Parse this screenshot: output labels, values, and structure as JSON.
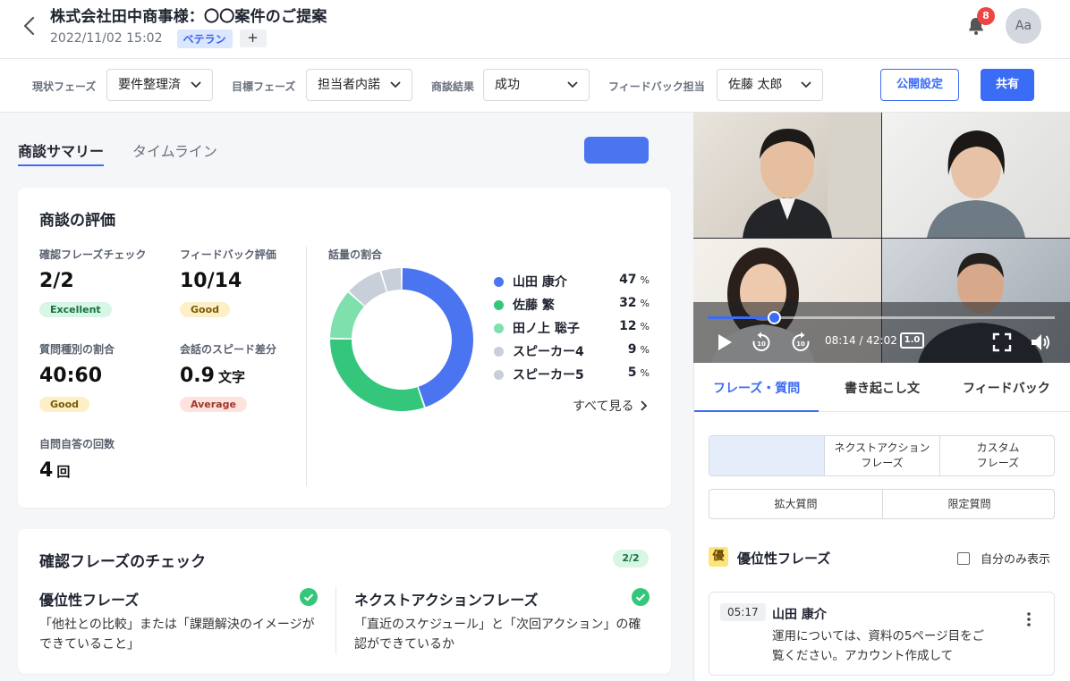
{
  "header": {
    "title": "株式会社田中商事様：〇〇案件のご提案",
    "datetime": "2022/11/02 15:02",
    "tag": "ベテラン",
    "tag_add": "+",
    "notification_count": "8",
    "avatar_initials": "Aa"
  },
  "filters": {
    "current_phase_label": "現状フェーズ",
    "current_phase_value": "要件整理済",
    "target_phase_label": "目標フェーズ",
    "target_phase_value": "担当者内諾",
    "result_label": "商談結果",
    "result_value": "成功",
    "feedback_owner_label": "フィードバック担当",
    "feedback_owner_value": "佐藤 太郎",
    "publish_button": "公開設定",
    "share_button": "共有"
  },
  "left_tabs": {
    "summary": "商談サマリー",
    "timeline": "タイムライン"
  },
  "evaluation": {
    "title": "商談の評価",
    "metrics": [
      {
        "label": "確認フレーズチェック",
        "value": "2/2",
        "unit": "",
        "badge": "Excellent"
      },
      {
        "label": "フィードバック評価",
        "value": "10/14",
        "unit": "",
        "badge": "Good"
      },
      {
        "label": "質問種別の割合",
        "value": "40:60",
        "unit": "",
        "badge": "Good"
      },
      {
        "label": "会話のスピード差分",
        "value": "0.9",
        "unit": "文字",
        "badge": "Average"
      },
      {
        "label": "自問自答の回数",
        "value": "4",
        "unit": "回",
        "badge": ""
      }
    ],
    "talk_ratio_label": "話量の割合",
    "see_all": "すべて見る"
  },
  "chart_data": {
    "type": "pie",
    "title": "話量の割合",
    "categories": [
      "山田 康介",
      "佐藤 繁",
      "田ノ上 聡子",
      "スピーカー4",
      "スピーカー5"
    ],
    "values": [
      47,
      32,
      12,
      9,
      5
    ],
    "unit": "%",
    "colors": [
      "#4a74f0",
      "#34c77b",
      "#7de0ad",
      "#c9cfd8",
      "#c9cfd8"
    ]
  },
  "check_phrases": {
    "title": "確認フレーズのチェック",
    "count": "2/2",
    "items": [
      {
        "title": "優位性フレーズ",
        "desc_line1": "「他社との比較」または「課題解決のイメージが",
        "desc_line2": "できていること」"
      },
      {
        "title": "ネクストアクションフレーズ",
        "desc_line1": "「直近のスケジュール」と「次回アクション」の確",
        "desc_line2": "認ができているか"
      }
    ]
  },
  "video": {
    "time": "08:14 / 42:02",
    "speed": "1.0",
    "progress": 0.19
  },
  "right_tabs": {
    "phrases": "フレーズ・質問",
    "transcript": "書き起こし文",
    "feedback": "フィードバック"
  },
  "segments": {
    "next_action_line1": "ネクストアクション",
    "next_action_line2": "フレーズ",
    "custom_line1": "カスタム",
    "custom_line2": "フレーズ",
    "expand_question": "拡大質問",
    "limited_question": "限定質問"
  },
  "phrase_section": {
    "badge": "優",
    "title": "優位性フレーズ",
    "self_only": "自分のみ表示",
    "card": {
      "timestamp": "05:17",
      "speaker": "山田 康介",
      "text_line1": "運用については、資料の5ページ目をご",
      "text_line2": "覧ください。アカウント作成して"
    }
  }
}
